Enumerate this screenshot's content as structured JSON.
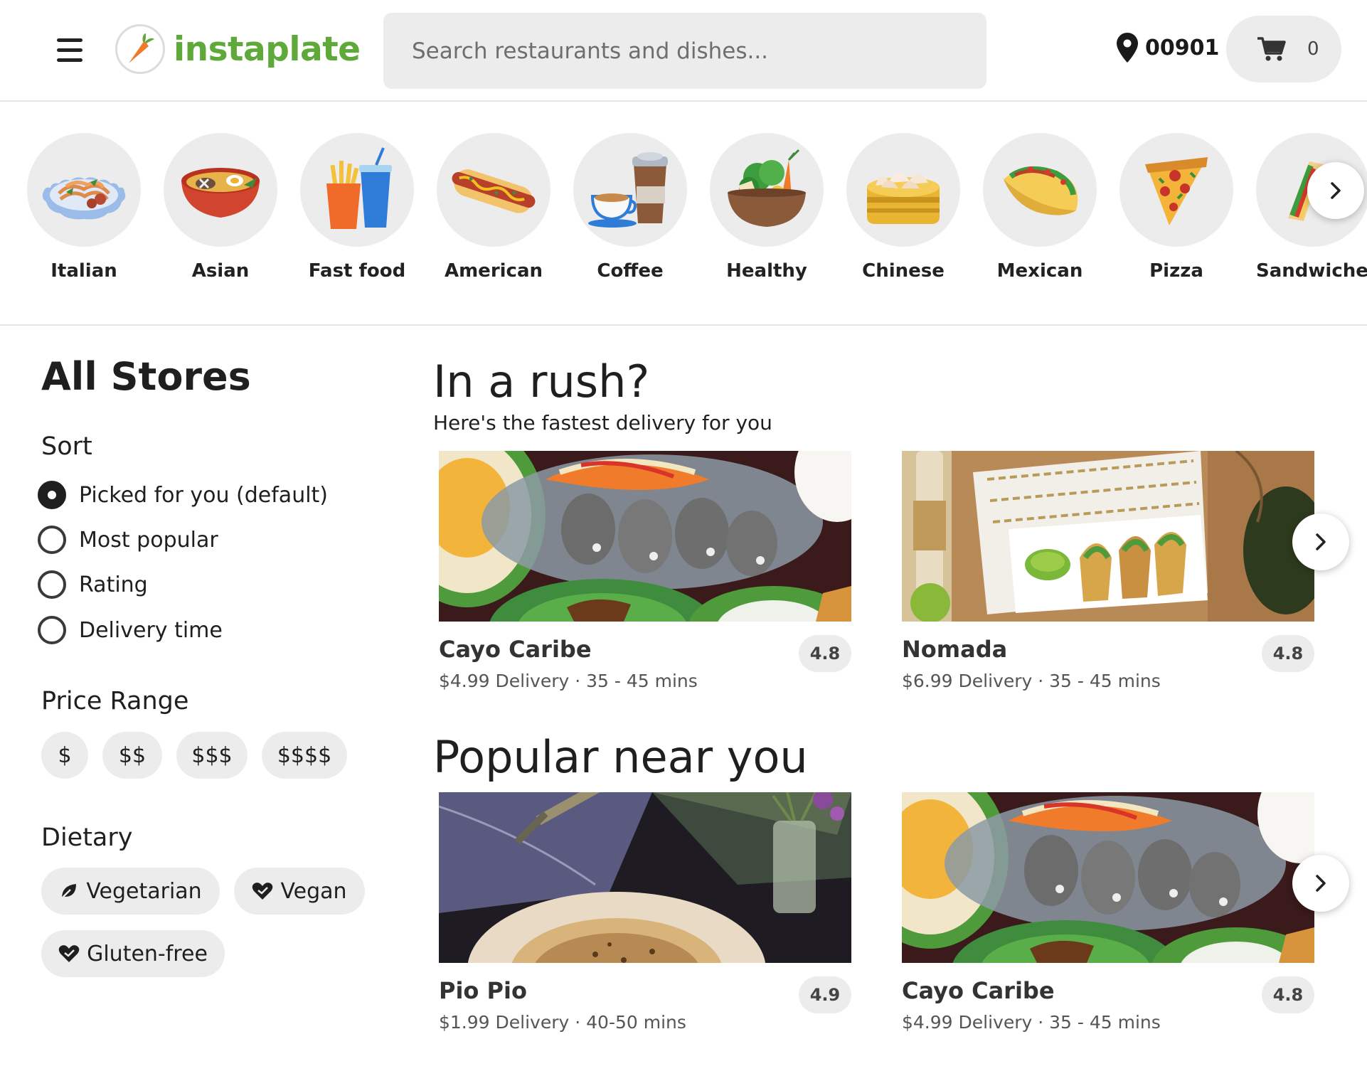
{
  "header": {
    "menu_icon": "hamburger-menu-icon",
    "logo_text": "instaplate",
    "search_placeholder": "Search restaurants and dishes...",
    "location": "00901",
    "cart_count": "0",
    "brand_color": "#5fa83a"
  },
  "categories": [
    {
      "label": "Italian",
      "icon": "pasta-icon"
    },
    {
      "label": "Asian",
      "icon": "ramen-bowl-icon"
    },
    {
      "label": "Fast food",
      "icon": "fries-soda-icon"
    },
    {
      "label": "American",
      "icon": "hotdog-icon"
    },
    {
      "label": "Coffee",
      "icon": "coffee-cup-icon"
    },
    {
      "label": "Healthy",
      "icon": "salad-bowl-icon"
    },
    {
      "label": "Chinese",
      "icon": "dumplings-icon"
    },
    {
      "label": "Mexican",
      "icon": "taco-icon"
    },
    {
      "label": "Pizza",
      "icon": "pizza-slice-icon"
    },
    {
      "label": "Sandwiches",
      "icon": "sandwich-icon"
    }
  ],
  "sidebar": {
    "title": "All Stores",
    "sort_title": "Sort",
    "sort_options": [
      {
        "label": "Picked for you (default)",
        "checked": true
      },
      {
        "label": "Most popular",
        "checked": false
      },
      {
        "label": "Rating",
        "checked": false
      },
      {
        "label": "Delivery time",
        "checked": false
      }
    ],
    "price_title": "Price Range",
    "prices": [
      "$",
      "$$",
      "$$$",
      "$$$$"
    ],
    "dietary_title": "Dietary",
    "dietary": [
      {
        "label": "Vegetarian",
        "icon": "leaf-icon"
      },
      {
        "label": "Vegan",
        "icon": "heart-icon"
      },
      {
        "label": "Gluten-free",
        "icon": "heart-icon"
      }
    ]
  },
  "rush": {
    "title": "In a rush?",
    "subtitle": "Here's the fastest delivery for you",
    "cards": [
      {
        "name": "Cayo Caribe",
        "rating": "4.8",
        "meta": "$4.99 Delivery · 35 - 45 mins"
      },
      {
        "name": "Nomada",
        "rating": "4.8",
        "meta": "$6.99 Delivery · 35 - 45 mins"
      }
    ]
  },
  "popular": {
    "title": "Popular near you",
    "cards": [
      {
        "name": "Pio Pio",
        "rating": "4.9",
        "meta": "$1.99 Delivery · 40-50 mins"
      },
      {
        "name": "Cayo Caribe",
        "rating": "4.8",
        "meta": "$4.99 Delivery · 35 - 45 mins"
      }
    ]
  }
}
